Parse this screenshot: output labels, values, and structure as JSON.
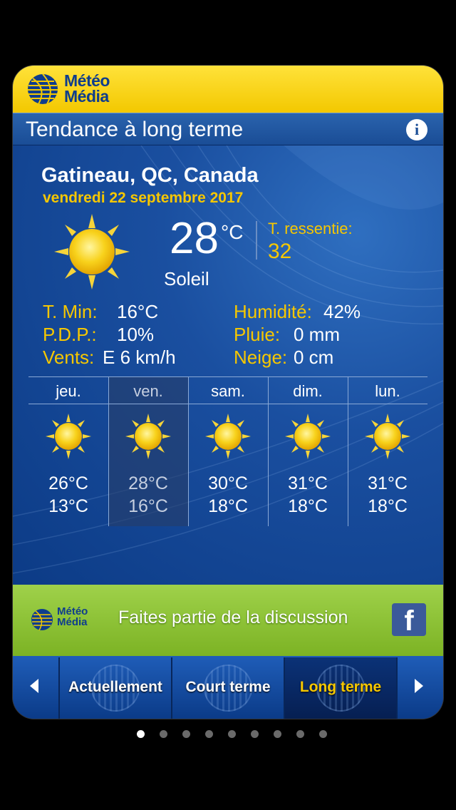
{
  "brand": {
    "logo_line1": "Météo",
    "logo_line2": "Média"
  },
  "header": {
    "title": "Tendance à long terme",
    "info_icon": "info-icon"
  },
  "current": {
    "location": "Gatineau, QC, Canada",
    "date": "vendredi 22 septembre 2017",
    "temperature": "28",
    "unit": "°C",
    "condition": "Soleil",
    "condition_icon": "sun-icon",
    "feels_like_label": "T. ressentie:",
    "feels_like_value": "32",
    "stats": {
      "tmin_label": "T. Min:",
      "tmin_value": "16°C",
      "pdp_label": "P.D.P.:",
      "pdp_value": "10%",
      "wind_label": "Vents:",
      "wind_value": "E 6 km/h",
      "humidity_label": "Humidité:",
      "humidity_value": "42%",
      "rain_label": "Pluie:",
      "rain_value": "0 mm",
      "snow_label": "Neige:",
      "snow_value": "0 cm"
    }
  },
  "forecast": [
    {
      "day": "jeu.",
      "high": "26°C",
      "low": "13°C",
      "icon": "sun-icon"
    },
    {
      "day": "ven.",
      "high": "28°C",
      "low": "16°C",
      "icon": "sun-icon",
      "selected": true
    },
    {
      "day": "sam.",
      "high": "30°C",
      "low": "18°C",
      "icon": "sun-icon"
    },
    {
      "day": "dim.",
      "high": "31°C",
      "low": "18°C",
      "icon": "sun-icon"
    },
    {
      "day": "lun.",
      "high": "31°C",
      "low": "18°C",
      "icon": "sun-icon"
    }
  ],
  "promo": {
    "logo_line1": "Météo",
    "logo_line2": "Média",
    "text": "Faites partie de la discussion",
    "social_icon": "facebook-icon",
    "social_glyph": "f"
  },
  "nav": {
    "items": [
      {
        "label": "Actuellement"
      },
      {
        "label": "Court terme"
      },
      {
        "label": "Long terme",
        "active": true
      }
    ],
    "prev_icon": "arrow-left-icon",
    "next_icon": "arrow-right-icon"
  },
  "pager": {
    "total": 9,
    "current": 1
  },
  "colors": {
    "accent_yellow": "#f6c700",
    "brand_blue": "#0f3d8c",
    "promo_green": "#8cc63f"
  }
}
